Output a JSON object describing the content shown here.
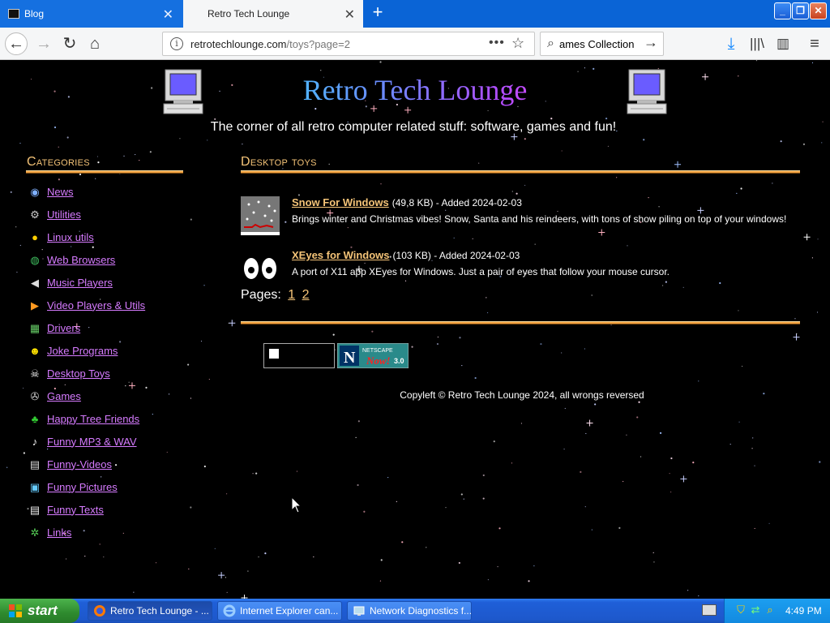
{
  "browser": {
    "tabs": [
      {
        "label": "Blog"
      },
      {
        "label": "Retro Tech Lounge"
      }
    ],
    "url_host": "retrotechlounge.com",
    "url_path": "/toys?page=2",
    "url_more": "•••",
    "search_value": "ames Collection"
  },
  "site": {
    "title": "Retro Tech Lounge",
    "tagline": "The corner of all retro computer related stuff: software, games and fun!"
  },
  "sidebar": {
    "heading": "Categories",
    "items": [
      {
        "label": "News",
        "icon": "globe-icon"
      },
      {
        "label": "Utilities",
        "icon": "utilities-icon"
      },
      {
        "label": "Linux utils",
        "icon": "tux-icon"
      },
      {
        "label": "Web Browsers",
        "icon": "earth-icon"
      },
      {
        "label": "Music Players",
        "icon": "speaker-icon"
      },
      {
        "label": "Video Players & Utils",
        "icon": "video-icon"
      },
      {
        "label": "Drivers",
        "icon": "chip-icon"
      },
      {
        "label": "Joke Programs",
        "icon": "smiley-icon"
      },
      {
        "label": "Desktop Toys",
        "icon": "skull-icon"
      },
      {
        "label": "Games",
        "icon": "joystick-icon"
      },
      {
        "label": "Happy Tree Friends",
        "icon": "tree-icon"
      },
      {
        "label": "Funny MP3 & WAV",
        "icon": "music-note-icon"
      },
      {
        "label": "Funny-Videos",
        "icon": "clapper-icon"
      },
      {
        "label": "Funny Pictures",
        "icon": "picture-icon"
      },
      {
        "label": "Funny Texts",
        "icon": "document-icon"
      },
      {
        "label": "Links",
        "icon": "link-icon"
      }
    ]
  },
  "main": {
    "heading": "Desktop toys",
    "items": [
      {
        "title": "Snow For Windows",
        "meta": "(49,8 KB) - Added 2024-02-03",
        "description": "Brings winter and Christmas vibes! Snow, Santa and his reindeers, with tons of show piling on top of your windows!"
      },
      {
        "title": "XEyes for Windows",
        "meta": "(103 KB) - Added 2024-02-03",
        "description": "A port of X11 app XEyes for Windows. Just a pair of eyes that follow your mouse cursor."
      }
    ],
    "pages_label": "Pages:",
    "pages": [
      "1",
      "2"
    ],
    "badge_text": "NETSCAPE",
    "badge_sub": "Now!",
    "badge_version": "3.0",
    "copyleft": "Copyleft © Retro Tech Lounge 2024, all wrongs reversed"
  },
  "taskbar": {
    "start_label": "start",
    "tasks": [
      {
        "label": "Retro Tech Lounge - ..."
      },
      {
        "label": "Internet Explorer can..."
      },
      {
        "label": "Network Diagnostics f..."
      }
    ],
    "clock": "4:49 PM"
  },
  "colors": {
    "link_purple": "#d67bff",
    "heading_gold": "#f5c478",
    "rule_orange": "#f0a040",
    "taskbar_blue": "#1f5fd8",
    "start_green": "#2e8a2e"
  }
}
